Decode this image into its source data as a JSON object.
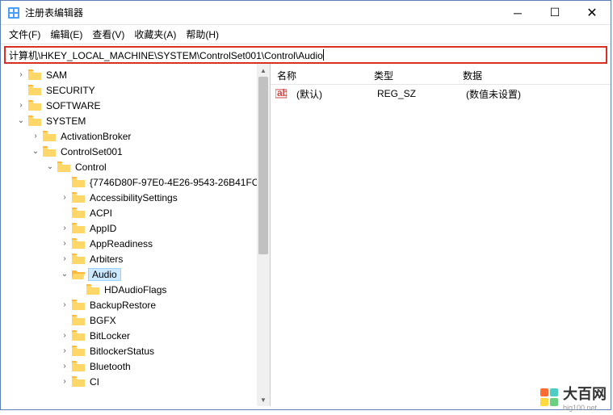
{
  "window": {
    "title": "注册表编辑器"
  },
  "menu": {
    "file": "文件(F)",
    "edit": "编辑(E)",
    "view": "查看(V)",
    "favorites": "收藏夹(A)",
    "help": "帮助(H)"
  },
  "address": "计算机\\HKEY_LOCAL_MACHINE\\SYSTEM\\ControlSet001\\Control\\Audio",
  "tree": {
    "sam": "SAM",
    "security": "SECURITY",
    "software": "SOFTWARE",
    "system": "SYSTEM",
    "activation_broker": "ActivationBroker",
    "controlset001": "ControlSet001",
    "control": "Control",
    "guid": "{7746D80F-97E0-4E26-9543-26B41FC",
    "accessibility": "AccessibilitySettings",
    "acpi": "ACPI",
    "appid": "AppID",
    "appreadiness": "AppReadiness",
    "arbiters": "Arbiters",
    "audio": "Audio",
    "hdaudioflags": "HDAudioFlags",
    "backuprestore": "BackupRestore",
    "bgfx": "BGFX",
    "bitlocker": "BitLocker",
    "bitlockerstatus": "BitlockerStatus",
    "bluetooth": "Bluetooth",
    "ci": "CI"
  },
  "list": {
    "columns": {
      "name": "名称",
      "type": "类型",
      "data": "数据"
    },
    "rows": [
      {
        "name": "(默认)",
        "type": "REG_SZ",
        "data": "(数值未设置)"
      }
    ]
  },
  "watermark": {
    "brand": "大百网",
    "url": "big100.net"
  }
}
